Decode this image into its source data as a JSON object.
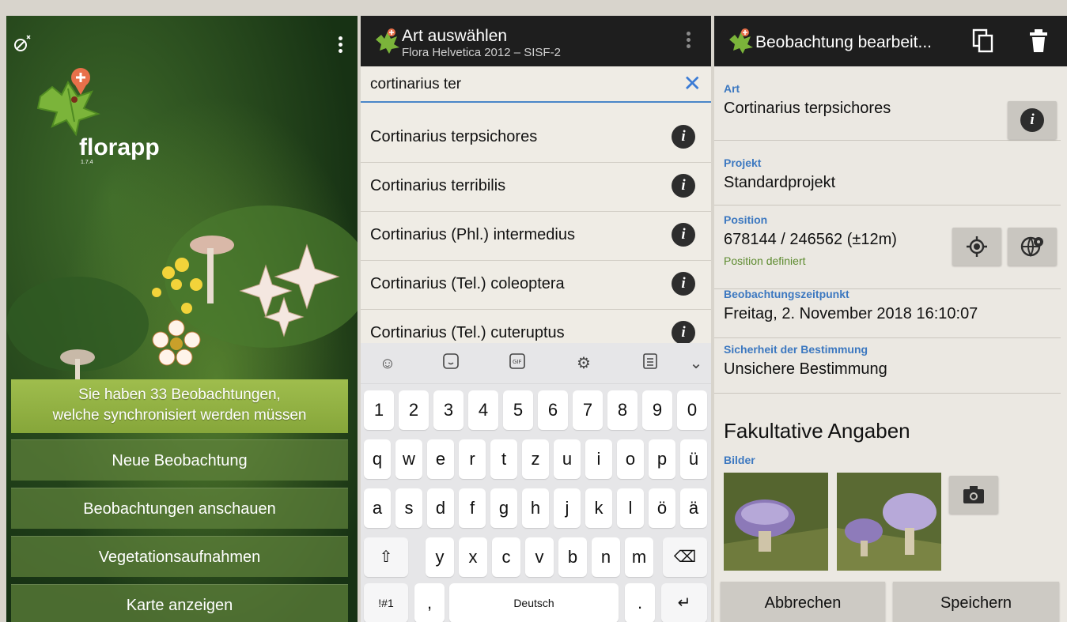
{
  "home": {
    "app_name": "florapp",
    "version": "1.7.4",
    "sync_banner": [
      "Sie haben 33 Beobachtungen,",
      "welche synchronisiert werden müssen"
    ],
    "menu": [
      "Neue Beobachtung",
      "Beobachtungen anschauen",
      "Vegetationsaufnahmen",
      "Karte anzeigen"
    ]
  },
  "species_search": {
    "title": "Art auswählen",
    "subtitle": "Flora Helvetica 2012 – SISF-2",
    "search_value": "cortinarius ter",
    "clear_icon": "close-icon",
    "results": [
      "Cortinarius terpsichores",
      "Cortinarius terribilis",
      "Cortinarius (Phl.) intermedius",
      "Cortinarius (Tel.) coleoptera",
      "Cortinarius (Tel.) cuteruptus"
    ],
    "info_glyph": "i",
    "keyboard": {
      "toolbar_icons": [
        "emoji-icon",
        "sticker-icon",
        "gif-icon",
        "settings-icon",
        "clipboard-icon",
        "collapse-icon"
      ],
      "row1": [
        "1",
        "2",
        "3",
        "4",
        "5",
        "6",
        "7",
        "8",
        "9",
        "0"
      ],
      "row2": [
        "q",
        "w",
        "e",
        "r",
        "t",
        "z",
        "u",
        "i",
        "o",
        "p",
        "ü"
      ],
      "row3": [
        "a",
        "s",
        "d",
        "f",
        "g",
        "h",
        "j",
        "k",
        "l",
        "ö",
        "ä"
      ],
      "row4": [
        "y",
        "x",
        "c",
        "v",
        "b",
        "n",
        "m"
      ],
      "symbols_key": "!#1",
      "comma_key": ",",
      "space_key": "Deutsch",
      "period_key": ".",
      "shift_glyph": "⇧",
      "backspace_glyph": "⌫",
      "enter_glyph": "↵"
    }
  },
  "edit_observation": {
    "title": "Beobachtung bearbeit...",
    "toolbar_icons": [
      "copy-icon",
      "delete-icon"
    ],
    "fields": {
      "art": {
        "label": "Art",
        "value": "Cortinarius terpsichores"
      },
      "projekt": {
        "label": "Projekt",
        "value": "Standardprojekt"
      },
      "position": {
        "label": "Position",
        "value": "678144 / 246562 (±12m)",
        "note": "Position definiert"
      },
      "zeitpunkt": {
        "label": "Beobachtungszeitpunkt",
        "value": "Freitag, 2. November 2018 16:10:07"
      },
      "sicherheit": {
        "label": "Sicherheit der Bestimmung",
        "value": "Unsichere Bestimmung"
      }
    },
    "optional_heading": "Fakultative Angaben",
    "images_label": "Bilder",
    "buttons": {
      "cancel": "Abbrechen",
      "save": "Speichern"
    },
    "colors": {
      "accent": "#3c78c0",
      "ok": "#5d8b2f",
      "appbar": "#1e1e1e"
    }
  }
}
